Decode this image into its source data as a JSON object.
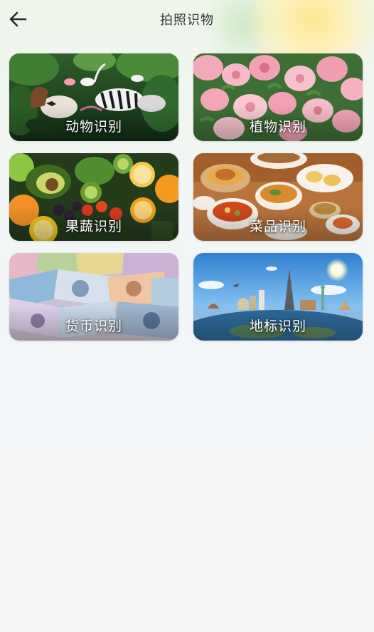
{
  "header": {
    "title": "拍照识物",
    "back_icon": "arrow-left-icon"
  },
  "categories": [
    {
      "label": "动物识别",
      "theme": "animals",
      "accent": "#1e4d22"
    },
    {
      "label": "植物识别",
      "theme": "plants",
      "accent": "#f0a3b4"
    },
    {
      "label": "果蔬识别",
      "theme": "fruits-vegetables",
      "accent": "#f59a1e"
    },
    {
      "label": "菜品识别",
      "theme": "dishes",
      "accent": "#c97a3a"
    },
    {
      "label": "货币识别",
      "theme": "currency",
      "accent": "#8fb2d6"
    },
    {
      "label": "地标识别",
      "theme": "landmarks",
      "accent": "#3f8fd6"
    }
  ]
}
